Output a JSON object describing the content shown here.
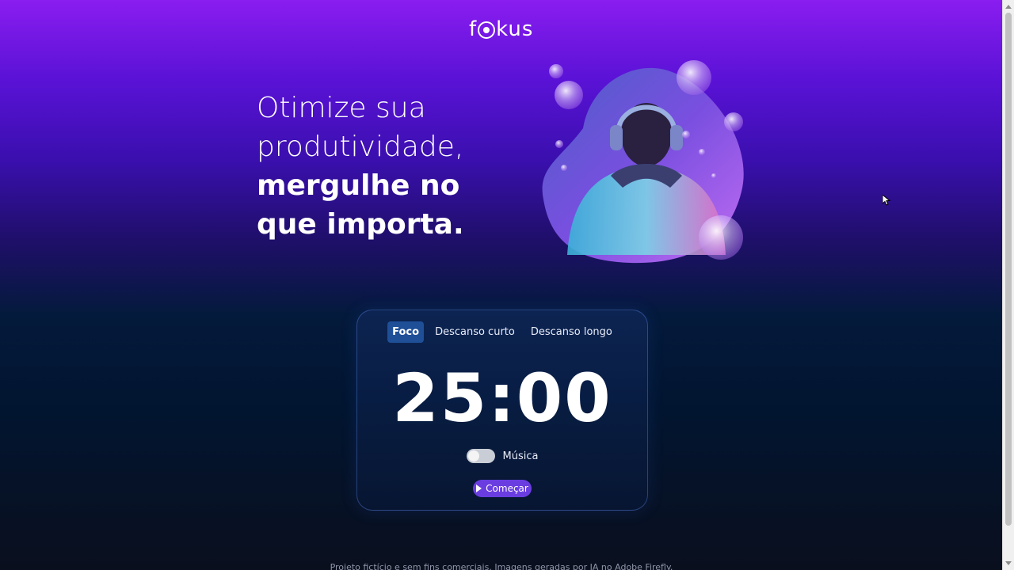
{
  "header": {
    "logo_text_start": "f",
    "logo_text_end": "kus"
  },
  "hero": {
    "line1": "Otimize sua",
    "line2": "produtividade,",
    "line3": "mergulhe no",
    "line4": "que importa."
  },
  "timer": {
    "tabs": [
      {
        "label": "Foco",
        "active": true
      },
      {
        "label": "Descanso curto",
        "active": false
      },
      {
        "label": "Descanso longo",
        "active": false
      }
    ],
    "time": "25:00",
    "music_label": "Música",
    "music_on": false,
    "start_label": "Começar"
  },
  "footer": {
    "text": "Projeto fictício e sem fins comerciais. Imagens geradas por IA no Adobe Firefly."
  },
  "colors": {
    "accent": "#6a3de0",
    "active_tab": "#1f4f97"
  },
  "icons": {
    "start": "play-icon",
    "logo_mark": "focus-ring-icon"
  }
}
